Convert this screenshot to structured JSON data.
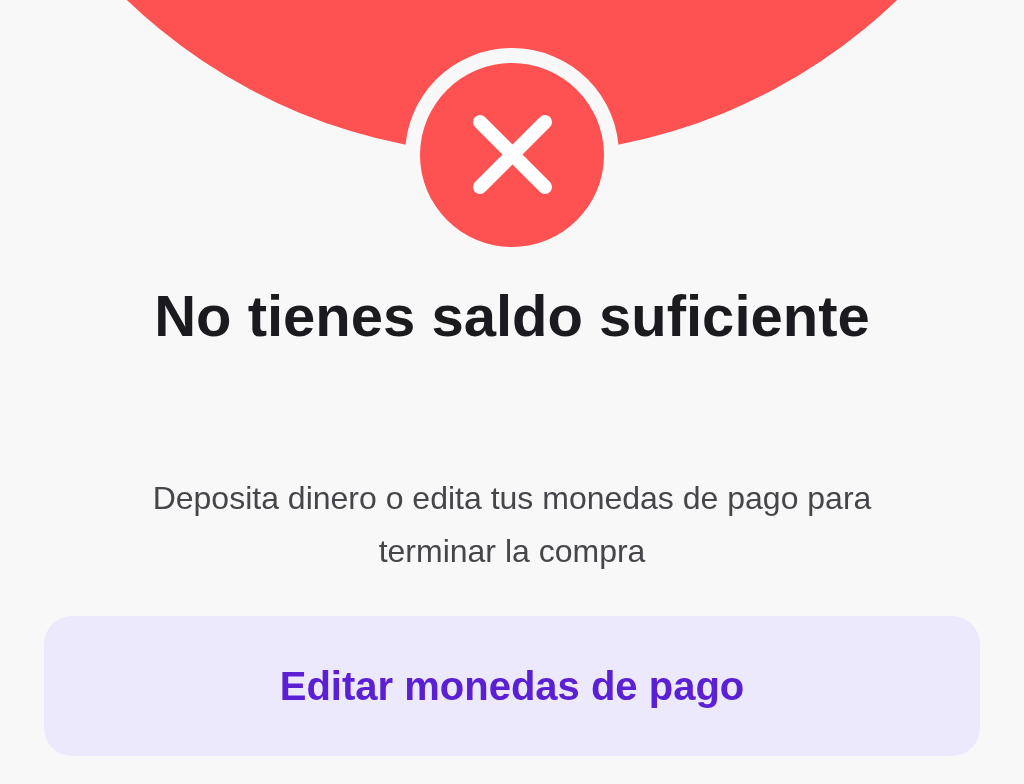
{
  "title": "No tienes saldo suficiente",
  "message": "Deposita dinero o edita tus monedas de pago para terminar la compra",
  "button": {
    "label": "Editar monedas de pago"
  }
}
